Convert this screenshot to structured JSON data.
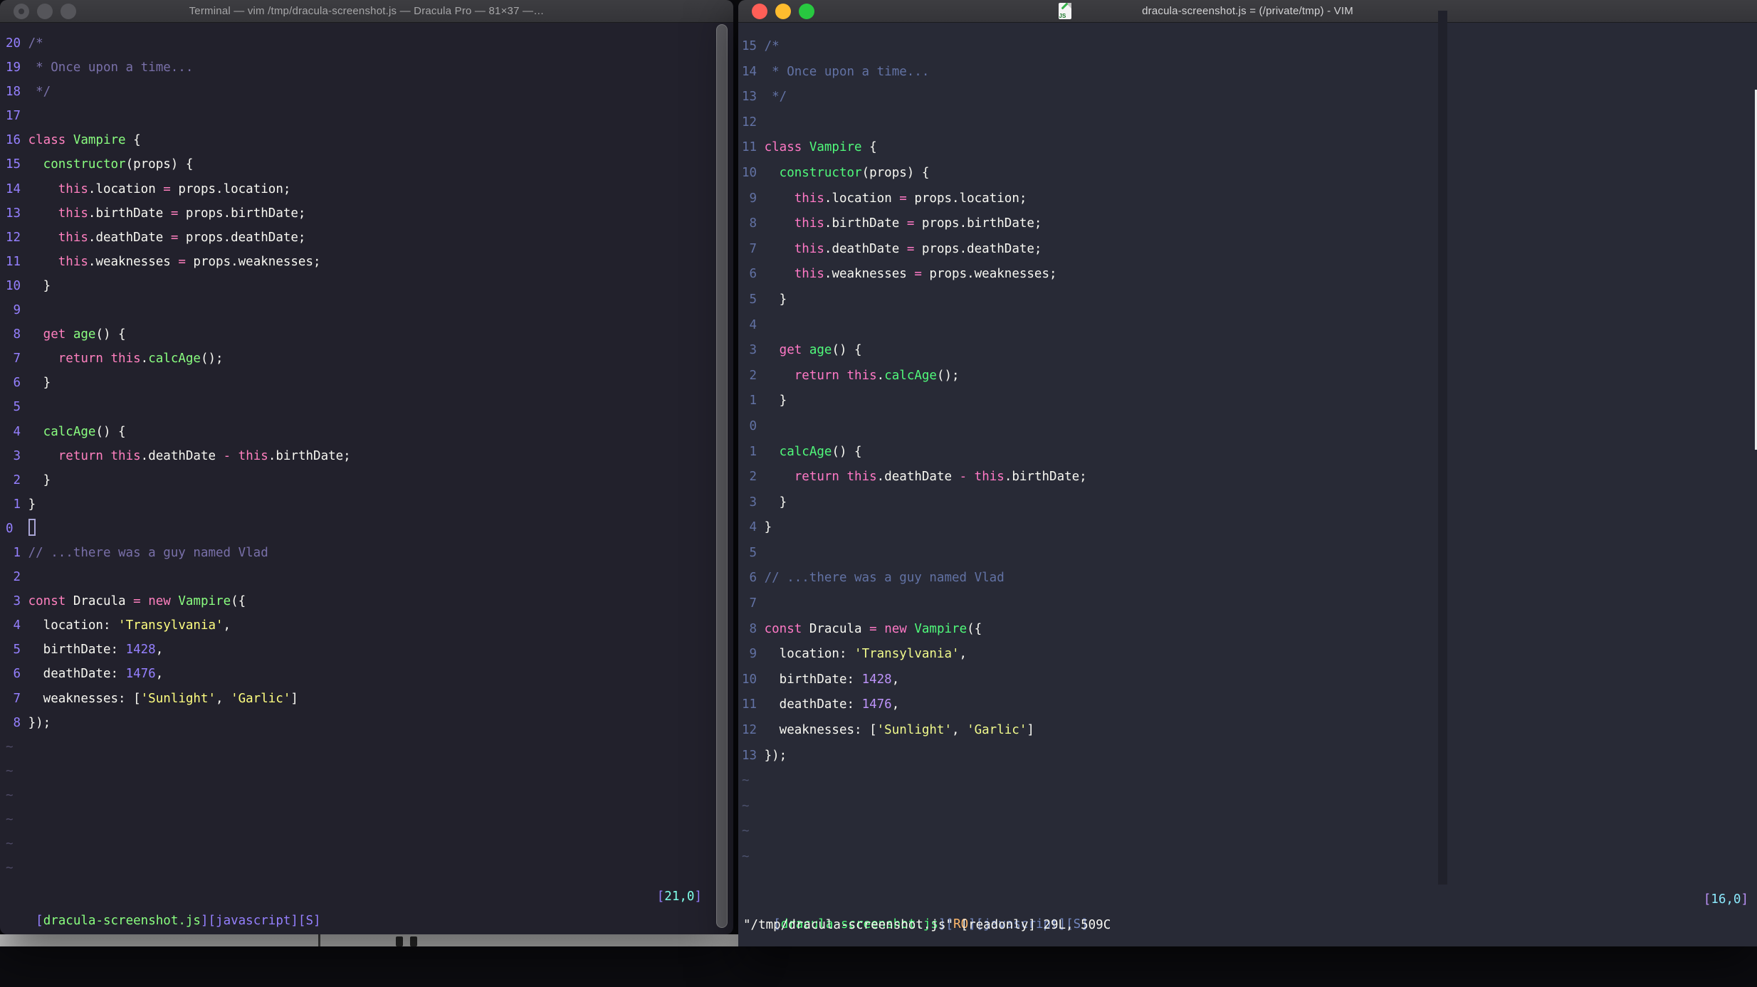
{
  "code": {
    "tilde_glyph": "~",
    "lines": [
      [
        [
          "/*",
          "comment"
        ]
      ],
      [
        [
          " * Once upon a time...",
          "comment"
        ]
      ],
      [
        [
          " */",
          "comment"
        ]
      ],
      [],
      [
        [
          "class",
          "pink"
        ],
        [
          " ",
          "fg"
        ],
        [
          "Vampire",
          "green"
        ],
        [
          " {",
          "fg"
        ]
      ],
      [
        [
          "  ",
          "fg"
        ],
        [
          "constructor",
          "green"
        ],
        [
          "(props) {",
          "fg"
        ]
      ],
      [
        [
          "    ",
          "fg"
        ],
        [
          "this",
          "pink"
        ],
        [
          ".location ",
          "fg"
        ],
        [
          "=",
          "pink"
        ],
        [
          " props.location;",
          "fg"
        ]
      ],
      [
        [
          "    ",
          "fg"
        ],
        [
          "this",
          "pink"
        ],
        [
          ".birthDate ",
          "fg"
        ],
        [
          "=",
          "pink"
        ],
        [
          " props.birthDate;",
          "fg"
        ]
      ],
      [
        [
          "    ",
          "fg"
        ],
        [
          "this",
          "pink"
        ],
        [
          ".deathDate ",
          "fg"
        ],
        [
          "=",
          "pink"
        ],
        [
          " props.deathDate;",
          "fg"
        ]
      ],
      [
        [
          "    ",
          "fg"
        ],
        [
          "this",
          "pink"
        ],
        [
          ".weaknesses ",
          "fg"
        ],
        [
          "=",
          "pink"
        ],
        [
          " props.weaknesses;",
          "fg"
        ]
      ],
      [
        [
          "  }",
          "fg"
        ]
      ],
      [],
      [
        [
          "  ",
          "fg"
        ],
        [
          "get",
          "pink"
        ],
        [
          " ",
          "fg"
        ],
        [
          "age",
          "green"
        ],
        [
          "() {",
          "fg"
        ]
      ],
      [
        [
          "    ",
          "fg"
        ],
        [
          "return",
          "pink"
        ],
        [
          " ",
          "fg"
        ],
        [
          "this",
          "pink"
        ],
        [
          ".",
          "fg"
        ],
        [
          "calcAge",
          "green"
        ],
        [
          "();",
          "fg"
        ]
      ],
      [
        [
          "  }",
          "fg"
        ]
      ],
      [],
      [
        [
          "  ",
          "fg"
        ],
        [
          "calcAge",
          "green"
        ],
        [
          "() {",
          "fg"
        ]
      ],
      [
        [
          "    ",
          "fg"
        ],
        [
          "return",
          "pink"
        ],
        [
          " ",
          "fg"
        ],
        [
          "this",
          "pink"
        ],
        [
          ".deathDate ",
          "fg"
        ],
        [
          "-",
          "pink"
        ],
        [
          " ",
          "fg"
        ],
        [
          "this",
          "pink"
        ],
        [
          ".birthDate;",
          "fg"
        ]
      ],
      [
        [
          "  }",
          "fg"
        ]
      ],
      [
        [
          "}",
          "fg"
        ]
      ],
      [],
      [
        [
          "// ...there was a guy named Vlad",
          "comment"
        ]
      ],
      [],
      [
        [
          "const",
          "pink"
        ],
        [
          " Dracula ",
          "fg"
        ],
        [
          "=",
          "pink"
        ],
        [
          " ",
          "fg"
        ],
        [
          "new",
          "pink"
        ],
        [
          " ",
          "fg"
        ],
        [
          "Vampire",
          "green"
        ],
        [
          "({",
          "fg"
        ]
      ],
      [
        [
          "  location: ",
          "fg"
        ],
        [
          "'Transylvania'",
          "yellow"
        ],
        [
          ",",
          "fg"
        ]
      ],
      [
        [
          "  birthDate: ",
          "fg"
        ],
        [
          "1428",
          "purple"
        ],
        [
          ",",
          "fg"
        ]
      ],
      [
        [
          "  deathDate: ",
          "fg"
        ],
        [
          "1476",
          "purple"
        ],
        [
          ",",
          "fg"
        ]
      ],
      [
        [
          "  weaknesses: [",
          "fg"
        ],
        [
          "'Sunlight'",
          "yellow"
        ],
        [
          ", ",
          "fg"
        ],
        [
          "'Garlic'",
          "yellow"
        ],
        [
          "]",
          "fg"
        ]
      ],
      [
        [
          "});",
          "fg"
        ]
      ]
    ]
  },
  "left_window": {
    "titlebar": {
      "title": "Terminal — vim /tmp/dracula-screenshot.js — Dracula Pro — 81×37 —…",
      "traffic_lights": [
        "close",
        "minimize",
        "zoom"
      ]
    },
    "theme_name": "Dracula Pro",
    "palette": {
      "background": "#22212C",
      "foreground": "#F8F8F2",
      "comment": "#7970A9",
      "pink": "#FF80BF",
      "green": "#8AFF80",
      "purple": "#9580FF",
      "yellow": "#FFFF80",
      "cyan": "#80FFEA",
      "line_number": "#9580FF"
    },
    "relative_numbers": [
      "20",
      "19",
      "18",
      "17",
      "16",
      "15",
      "14",
      "13",
      "12",
      "11",
      "10",
      " 9",
      " 8",
      " 7",
      " 6",
      " 5",
      " 4",
      " 3",
      " 2",
      " 1",
      "0",
      " 1",
      " 2",
      " 3",
      " 4",
      " 5",
      " 6",
      " 7",
      " 8"
    ],
    "cursor_index": 20,
    "cursor_style": "hollow",
    "cursor_num_left_aligned": true,
    "tilde_count": 6,
    "status_segments": [
      [
        "[",
        "statusbr"
      ],
      [
        "dracula-screenshot.js",
        "green"
      ],
      [
        "][javascript][S]",
        "statusbr"
      ]
    ],
    "ruler_segments": [
      [
        "[",
        "statusbr"
      ],
      [
        "21,0",
        "cyan"
      ],
      [
        "]",
        "statusbr"
      ]
    ],
    "cmd_segments": []
  },
  "right_window": {
    "titlebar": {
      "title": "dracula-screenshot.js = (/private/tmp) - VIM",
      "doc_icon_label": "JS",
      "traffic_lights": [
        "close",
        "minimize",
        "zoom"
      ]
    },
    "theme_name": "Dracula",
    "palette": {
      "background": "#282A36",
      "foreground": "#F8F8F2",
      "comment": "#6272A4",
      "pink": "#FF79C6",
      "green": "#50FA7B",
      "purple": "#BD93F9",
      "yellow": "#F1FA8C",
      "cyan": "#8BE9FD",
      "orange": "#FFB86C",
      "line_number": "#6272A4"
    },
    "relative_numbers": [
      "15",
      "14",
      "13",
      "12",
      "11",
      "10",
      " 9",
      " 8",
      " 7",
      " 6",
      " 5",
      " 4",
      " 3",
      " 2",
      " 1",
      " 0",
      " 1",
      " 2",
      " 3",
      " 4",
      " 5",
      " 6",
      " 7",
      " 8",
      " 9",
      "10",
      "11",
      "12",
      "13"
    ],
    "cursor_index": 15,
    "cursor_style": "none",
    "cursor_num_left_aligned": false,
    "tilde_count": 4,
    "status_segments": [
      [
        "[",
        "statusbr"
      ],
      [
        "dracula-screenshot.js",
        "green"
      ],
      [
        "]",
        "statusbr"
      ],
      [
        "[",
        "statusbr"
      ],
      [
        "RO",
        "orange"
      ],
      [
        "]",
        "statusbr"
      ],
      [
        "[javascript][S]",
        "statusbr"
      ]
    ],
    "ruler_segments": [
      [
        "[",
        "purple"
      ],
      [
        "16,0",
        "cyan"
      ],
      [
        "]",
        "purple"
      ]
    ],
    "cmd_segments": [
      [
        "\"/tmp/dracula-screenshot.js\" [readonly] 29L, 509C",
        "fg"
      ]
    ]
  }
}
